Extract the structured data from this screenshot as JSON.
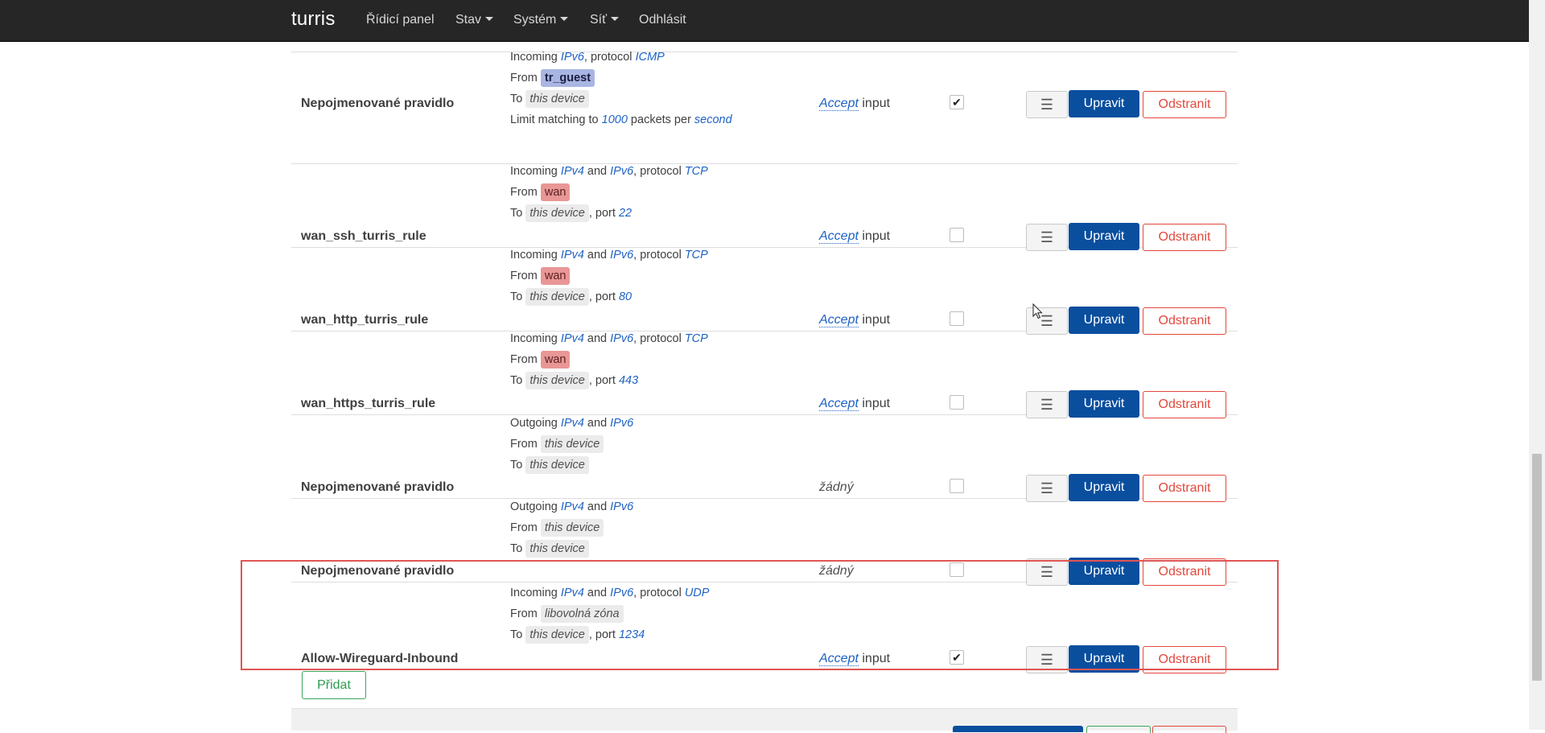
{
  "navbar": {
    "brand": "turris",
    "items": [
      {
        "label": "Řídicí panel",
        "dropdown": false
      },
      {
        "label": "Stav",
        "dropdown": true
      },
      {
        "label": "Systém",
        "dropdown": true
      },
      {
        "label": "Síť",
        "dropdown": true
      },
      {
        "label": "Odhlásit",
        "dropdown": false
      }
    ]
  },
  "buttons": {
    "menu": "☰",
    "edit": "Upravit",
    "delete": "Odstranit",
    "add": "Přidat"
  },
  "colors": {
    "navbar": "#262626",
    "edit_button": "#0a4e9e",
    "delete_button": "#e2483c",
    "add_button": "#3aa55d",
    "zone_wan": "#e99696",
    "zone_guest": "#a9b5e2",
    "highlight": "#e05555"
  },
  "rules": [
    {
      "name": "Nepojmenované pravidlo",
      "line1": {
        "pre": "Incoming ",
        "a": "IPv6",
        "mid": ", protocol ",
        "b": "ICMP"
      },
      "from": "tr_guest",
      "to": "this device",
      "limit": {
        "pre": "Limit matching to ",
        "a": "1000",
        "mid": " packets per ",
        "b": "second"
      },
      "action_link": "Accept",
      "action_text": " input",
      "enabled": true
    },
    {
      "name": "wan_ssh_turris_rule",
      "line1": {
        "pre": "Incoming ",
        "a": "IPv4",
        "mid": " and ",
        "b": "IPv6",
        "mid2": ", protocol ",
        "c": "TCP"
      },
      "from": "wan",
      "to": "this device",
      "port_label": ", port ",
      "port": "22",
      "action_link": "Accept",
      "action_text": " input",
      "enabled": false
    },
    {
      "name": "wan_http_turris_rule",
      "line1": {
        "pre": "Incoming ",
        "a": "IPv4",
        "mid": " and ",
        "b": "IPv6",
        "mid2": ", protocol ",
        "c": "TCP"
      },
      "from": "wan",
      "to": "this device",
      "port_label": ", port ",
      "port": "80",
      "action_link": "Accept",
      "action_text": " input",
      "enabled": false
    },
    {
      "name": "wan_https_turris_rule",
      "line1": {
        "pre": "Incoming ",
        "a": "IPv4",
        "mid": " and ",
        "b": "IPv6",
        "mid2": ", protocol ",
        "c": "TCP"
      },
      "from": "wan",
      "to": "this device",
      "port_label": ", port ",
      "port": "443",
      "action_link": "Accept",
      "action_text": " input",
      "enabled": false
    },
    {
      "name": "Nepojmenované pravidlo",
      "line1": {
        "pre": "Outgoing ",
        "a": "IPv4",
        "mid": " and ",
        "b": "IPv6"
      },
      "from": "this device",
      "to": "this device",
      "action_plain": "žádný",
      "enabled": false
    },
    {
      "name": "Nepojmenované pravidlo",
      "line1": {
        "pre": "Outgoing ",
        "a": "IPv4",
        "mid": " and ",
        "b": "IPv6"
      },
      "from": "this device",
      "to": "this device",
      "action_plain": "žádný",
      "enabled": false
    },
    {
      "name": "Allow-Wireguard-Inbound",
      "line1": {
        "pre": "Incoming ",
        "a": "IPv4",
        "mid": " and ",
        "b": "IPv6",
        "mid2": ", protocol ",
        "c": "UDP"
      },
      "from": "libovolná zóna",
      "to": "this device",
      "port_label": ", port ",
      "port": "1234",
      "action_link": "Accept",
      "action_text": " input",
      "enabled": true
    }
  ],
  "labels": {
    "from": "From ",
    "to": "To "
  }
}
